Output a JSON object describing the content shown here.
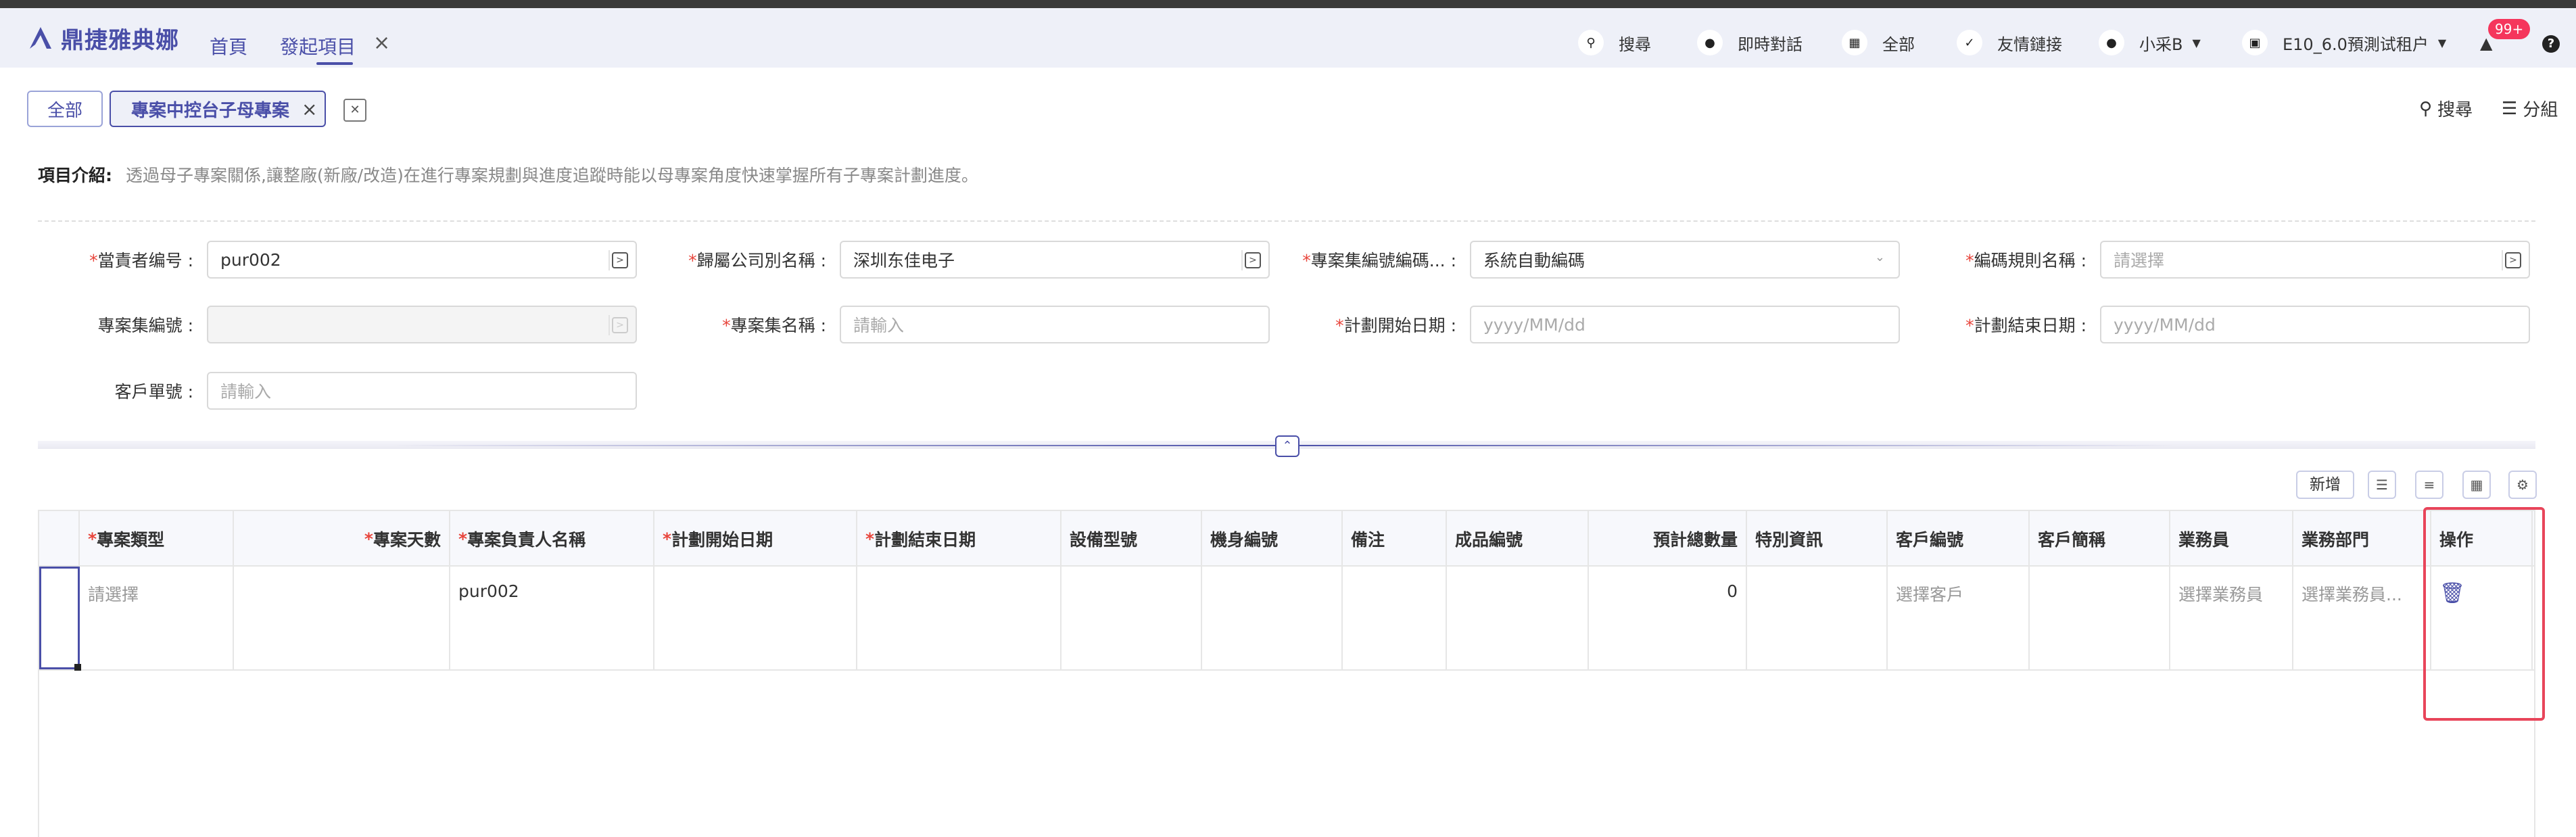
{
  "header": {
    "brand": "鼎捷雅典娜",
    "nav_home": "首頁",
    "nav_active": "發起項目",
    "nav_close": "×",
    "search": "搜尋",
    "chat": "即時對話",
    "all": "全部",
    "links": "友情鏈接",
    "user": "小采B",
    "tenant": "E10_6.0預測试租户",
    "badge": "99+",
    "help": "?"
  },
  "tabs": {
    "all": "全部",
    "current": "專案中控台子母專案",
    "current_close": "×",
    "search": "搜尋",
    "group": "分組"
  },
  "intro": {
    "label": "項目介紹:",
    "text": "透過母子專案關係,讓整廠(新廠/改造)在進行專案規劃與進度追蹤時能以母專案角度快速掌握所有子專案計劃進度。"
  },
  "form": {
    "owner_label": "當責者编号",
    "owner_value": "pur002",
    "company_label": "歸屬公司別名稱",
    "company_value": "深圳东佳电子",
    "coding_label": "專案集編號編碼...",
    "coding_value": "系統自動編碼",
    "rule_label": "編碼規則名稱",
    "rule_placeholder": "請選擇",
    "setno_label": "專案集編號",
    "setname_label": "專案集名稱",
    "setname_placeholder": "請輸入",
    "start_label": "計劃開始日期",
    "start_placeholder": "yyyy/MM/dd",
    "end_label": "計劃結束日期",
    "end_placeholder": "yyyy/MM/dd",
    "custno_label": "客戶單號",
    "custno_placeholder": "請輸入"
  },
  "toolbar": {
    "add": "新增"
  },
  "table": {
    "headers": {
      "type": "專案類型",
      "days": "專案天數",
      "owner": "專案負責人名稱",
      "start": "計劃開始日期",
      "end": "計劃結束日期",
      "model": "設備型號",
      "body": "機身編號",
      "note": "備注",
      "product": "成品編號",
      "qty": "預計總數量",
      "special": "特別資訊",
      "custcode": "客戶編號",
      "custabbr": "客戶簡稱",
      "sales": "業務員",
      "dept": "業務部門",
      "op": "操作"
    },
    "row": {
      "type": "請選擇",
      "owner": "pur002",
      "qty": "0",
      "custcode": "選擇客戶",
      "sales": "選擇業務員",
      "dept": "選擇業務員..."
    }
  },
  "icons": {
    "brand": "logo-a-icon",
    "search": "search-icon",
    "chat": "chat-icon",
    "all": "grid-icon",
    "links": "link-icon",
    "user": "user-icon",
    "tenant": "building-icon",
    "bell": "bell-icon",
    "trash": "trash-icon"
  },
  "colors": {
    "brand": "#4a4fa8",
    "required": "#e8453c",
    "highlight": "#e8455a",
    "badge": "#f5365c"
  }
}
